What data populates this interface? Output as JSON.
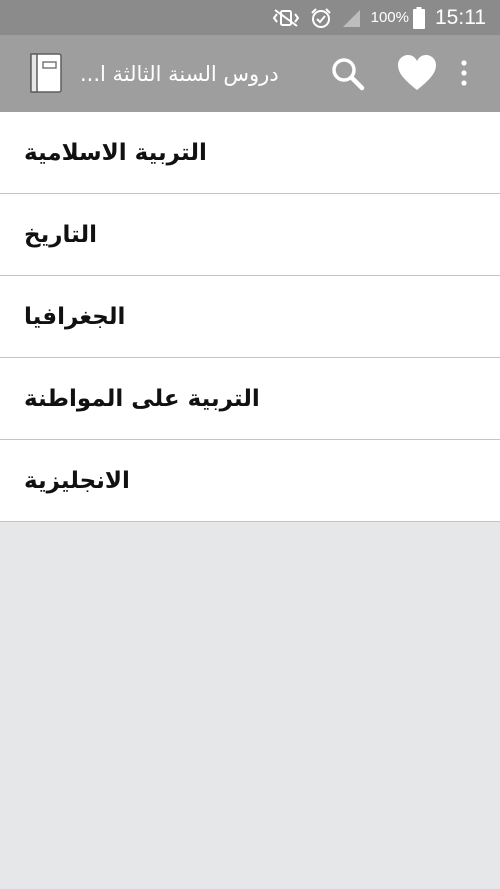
{
  "status_bar": {
    "icons": [
      "mute-vibrate-icon",
      "alarm-icon",
      "signal-icon",
      "battery-icon"
    ],
    "battery": "100%",
    "time": "15:11"
  },
  "app_bar": {
    "title": "دروس السنة الثالثة ا...",
    "icons": [
      "book-icon",
      "search-icon",
      "heart-icon",
      "overflow-menu-icon"
    ],
    "background": "#9e9e9e"
  },
  "subjects": [
    {
      "label": "التربية الاسلامية"
    },
    {
      "label": "التاريخ"
    },
    {
      "label": "الجغرافيا"
    },
    {
      "label": "التربية على المواطنة"
    },
    {
      "label": "الانجليزية"
    }
  ]
}
